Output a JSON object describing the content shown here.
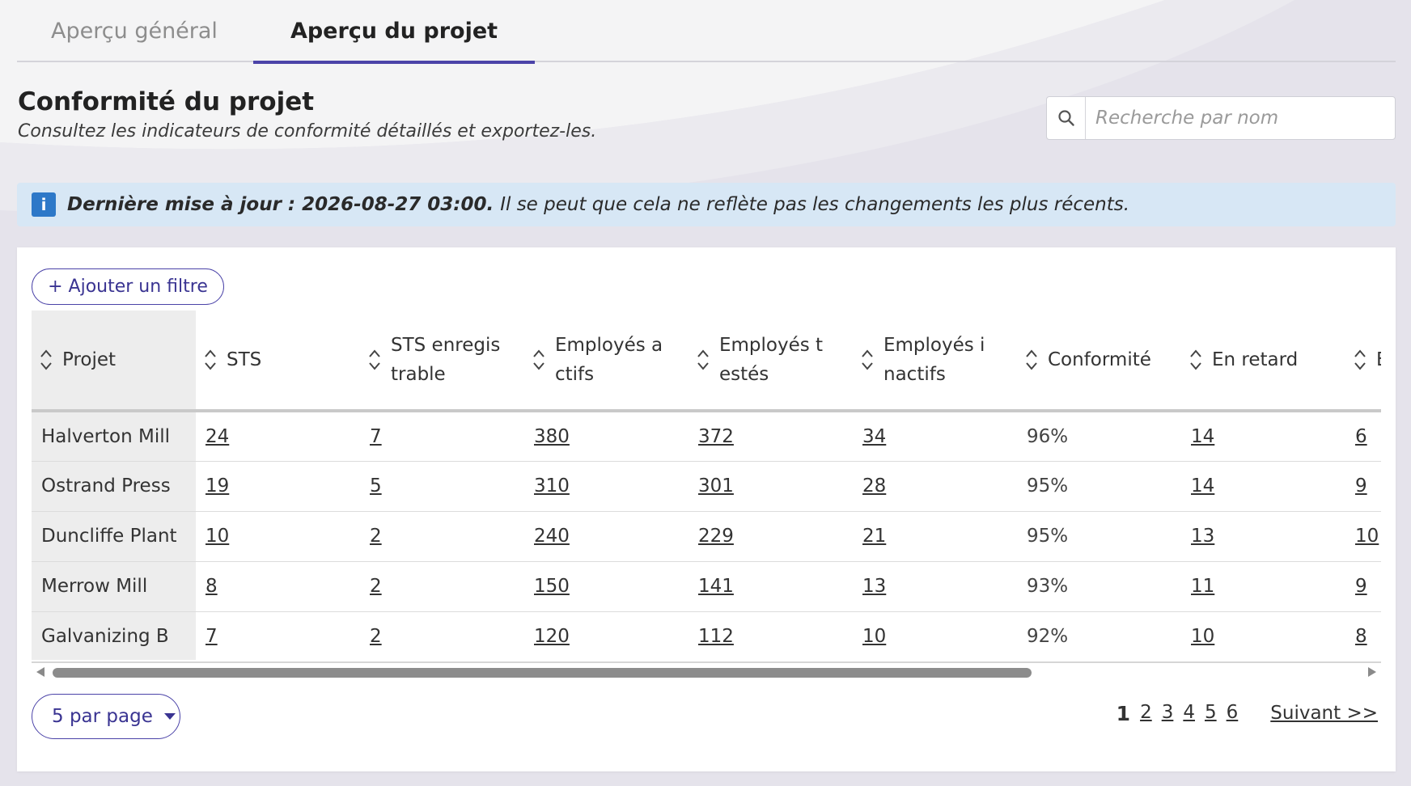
{
  "tabs": [
    {
      "label": "Aperçu général"
    },
    {
      "label": "Aperçu du projet"
    }
  ],
  "header": {
    "title": "Conformité du projet",
    "subtitle": "Consultez les indicateurs de conformité détaillés et exportez-les."
  },
  "search": {
    "placeholder": "Recherche par nom",
    "value": ""
  },
  "banner": {
    "strong": "Dernière mise à jour : 2026-08-27 03:00.",
    "text": "Il se peut que cela ne reflète pas les changements les plus récents."
  },
  "filter": {
    "add_label": "+ Ajouter un filtre"
  },
  "table": {
    "columns": [
      "Projet",
      "STS",
      "STS enregistrable",
      "Employés actifs",
      "Employés testés",
      "Employés inactifs",
      "Conformité",
      "En retard",
      "E ("
    ],
    "rows": [
      [
        "Halverton Mill",
        "24",
        "7",
        "380",
        "372",
        "34",
        "96%",
        "14",
        "6"
      ],
      [
        "Ostrand Press",
        "19",
        "5",
        "310",
        "301",
        "28",
        "95%",
        "14",
        "9"
      ],
      [
        "Duncliffe Plant",
        "10",
        "2",
        "240",
        "229",
        "21",
        "95%",
        "13",
        "10"
      ],
      [
        "Merrow Mill",
        "8",
        "2",
        "150",
        "141",
        "13",
        "93%",
        "11",
        "9"
      ],
      [
        "Galvanizing B",
        "7",
        "2",
        "120",
        "112",
        "10",
        "92%",
        "10",
        "8"
      ]
    ]
  },
  "footer": {
    "per_page": "5 par page",
    "pages": [
      "1",
      "2",
      "3",
      "4",
      "5",
      "6"
    ],
    "current_page": "1",
    "next": "Suivant >>"
  },
  "colors": {
    "accent": "#4b43a8",
    "banner_bg": "#d7e7f5",
    "info_icon": "#2d78c8"
  }
}
